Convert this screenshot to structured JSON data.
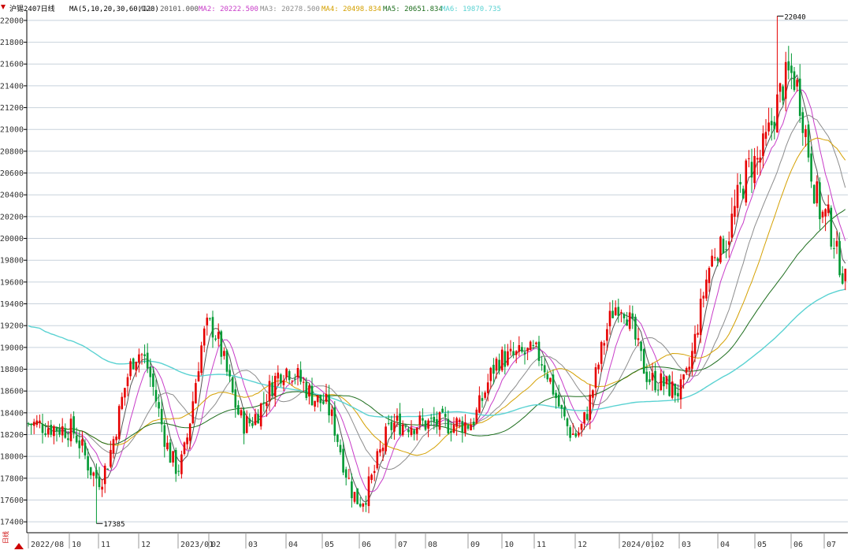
{
  "colors": {
    "up": "#e60000",
    "down": "#009933",
    "ma1": "#555555",
    "ma2": "#c83cc8",
    "ma3": "#8c8c8c",
    "ma4": "#d4a000",
    "ma5": "#1e6e1e",
    "ma6": "#5ad2d2",
    "grid": "#c8d2dc",
    "axis": "#000000",
    "arrow_marker": "#cc0000",
    "side_marker": "#cc0000"
  },
  "header": {
    "symbol_label": "沪锡2407日线",
    "ma_params": "MA(5,10,20,30,60,120)",
    "ma1_label": "MA1: 20101.000",
    "ma2_label": "MA2: 20222.500",
    "ma3_label": "MA3: 20278.500",
    "ma4_label": "MA4: 20498.834",
    "ma5_label": "MA5: 20651.834",
    "ma6_label": "MA6: 19870.735",
    "marker_up_icon": "red-down-arrow-icon"
  },
  "footer": {
    "period_label": "日线"
  },
  "chart_data": {
    "type": "candlestick",
    "title": "沪锡2407日线",
    "ylim": [
      17300,
      22050
    ],
    "yticks": [
      17400,
      17600,
      17800,
      18000,
      18200,
      18400,
      18600,
      18800,
      19000,
      19200,
      19400,
      19600,
      19800,
      20000,
      20200,
      20400,
      20600,
      20800,
      21000,
      21200,
      21400,
      21600,
      21800,
      22000
    ],
    "x_labels": [
      "2022/08",
      "10",
      "11",
      "12",
      "2023/01",
      "02",
      "03",
      "04",
      "05",
      "06",
      "07",
      "08",
      "09",
      "10",
      "11",
      "12",
      "2024/01",
      "02",
      "03",
      "04",
      "05",
      "06",
      "07"
    ],
    "annotations": [
      {
        "text": "22040",
        "value": 22040,
        "type": "high"
      },
      {
        "text": "17385",
        "value": 17385,
        "type": "low"
      }
    ],
    "anchors": [
      [
        "2022/08",
        18300
      ],
      [
        "10",
        18250
      ],
      [
        "11",
        17800
      ],
      [
        "12",
        18950
      ],
      [
        "2023/01",
        17900
      ],
      [
        "02",
        19200
      ],
      [
        "03",
        18300
      ],
      [
        "04",
        18800
      ],
      [
        "05",
        18500
      ],
      [
        "06",
        17600
      ],
      [
        "07",
        18300
      ],
      [
        "08",
        18300
      ],
      [
        "09",
        18300
      ],
      [
        "10",
        18900
      ],
      [
        "11",
        18950
      ],
      [
        "12",
        18200
      ],
      [
        "2024/01",
        19400
      ],
      [
        "02",
        18700
      ],
      [
        "03",
        18600
      ],
      [
        "04",
        19900
      ],
      [
        "05",
        20700
      ],
      [
        "06",
        21500
      ],
      [
        "07",
        20200
      ]
    ],
    "end_value": 19600,
    "grid": true,
    "series": [
      {
        "name": "MA(5,10,20,30,60,120)"
      }
    ]
  }
}
